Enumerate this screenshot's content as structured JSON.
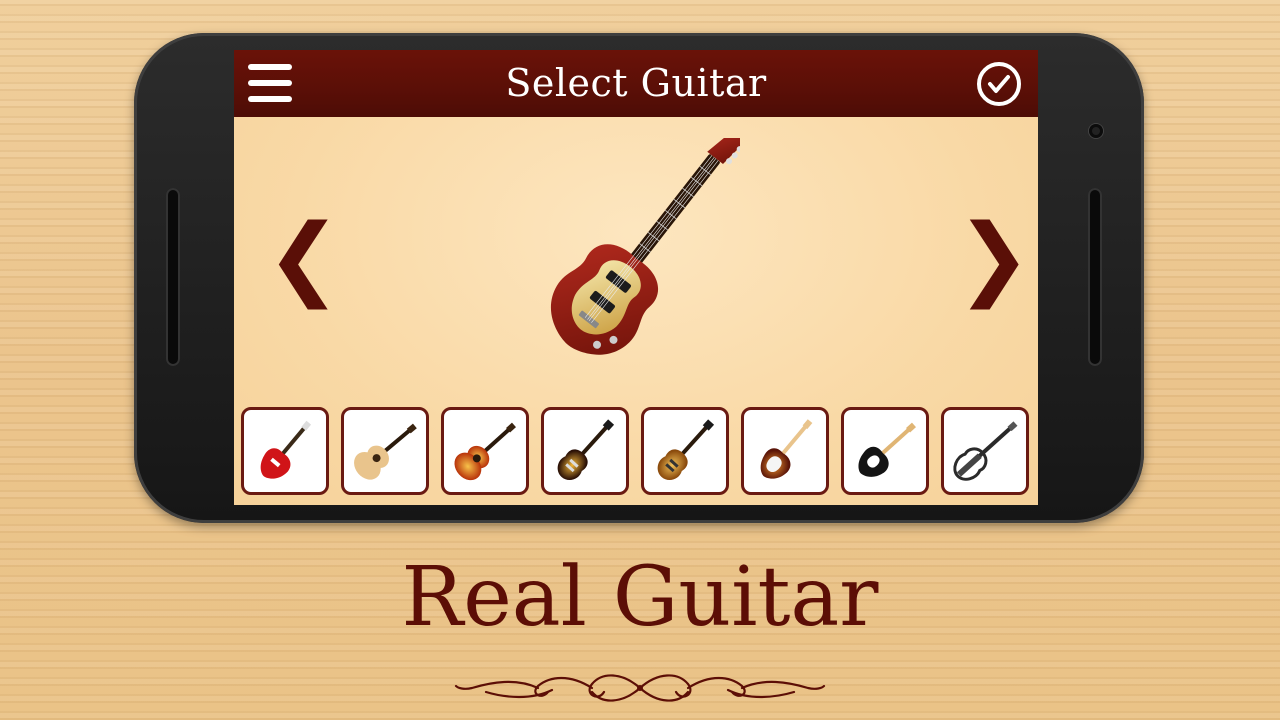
{
  "header": {
    "title": "Select Guitar",
    "menu_icon": "hamburger-menu-icon",
    "confirm_icon": "check-circle-icon"
  },
  "navigation": {
    "prev_label": "❮",
    "next_label": "❯"
  },
  "selected_guitar": {
    "icon": "electric-guitar-red-icon",
    "body_color": "#8e1a14"
  },
  "guitar_thumbnails": [
    {
      "icon": "electric-guitar-red-icon",
      "color": "#d01418"
    },
    {
      "icon": "acoustic-guitar-natural-icon",
      "color": "#e9c48c"
    },
    {
      "icon": "acoustic-guitar-sunburst-icon",
      "color": "#e5661a"
    },
    {
      "icon": "les-paul-sunburst-icon",
      "color": "#c47a18"
    },
    {
      "icon": "les-paul-gold-icon",
      "color": "#d6951c"
    },
    {
      "icon": "stratocaster-sunburst-icon",
      "color": "#a33614"
    },
    {
      "icon": "electric-guitar-black-icon",
      "color": "#141414"
    },
    {
      "icon": "silent-guitar-white-icon",
      "color": "#2a2a2a"
    }
  ],
  "brand": {
    "name": "Real Guitar"
  },
  "colors": {
    "accent": "#5a0f07",
    "screen_background": "#fde6bf"
  }
}
